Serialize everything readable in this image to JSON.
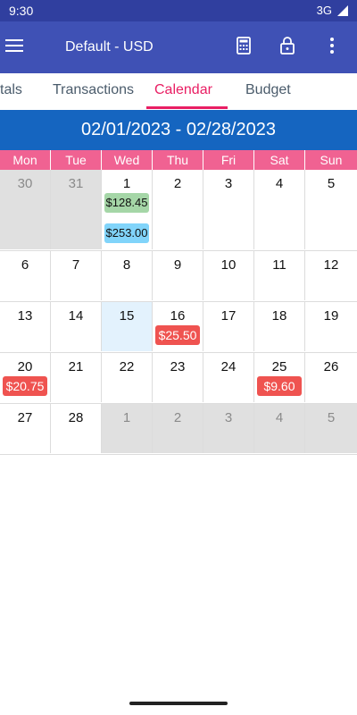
{
  "status_bar": {
    "time": "9:30",
    "network": "3G"
  },
  "app_bar": {
    "title": "Default - USD",
    "icons": [
      "menu-icon",
      "calculator-icon",
      "lock-icon",
      "more-vert-icon"
    ]
  },
  "tabs": [
    {
      "label": "tals",
      "active": false
    },
    {
      "label": "Transactions",
      "active": false
    },
    {
      "label": "Calendar",
      "active": true
    },
    {
      "label": "Budget",
      "active": false
    }
  ],
  "date_range": "02/01/2023 - 02/28/2023",
  "weekdays": [
    "Mon",
    "Tue",
    "Wed",
    "Thu",
    "Fri",
    "Sat",
    "Sun"
  ],
  "weeks": [
    [
      {
        "day": "30",
        "other": true
      },
      {
        "day": "31",
        "other": true
      },
      {
        "day": "1",
        "chips": [
          {
            "text": "$128.45",
            "color": "green"
          },
          {
            "text": "$253.00",
            "color": "blue"
          }
        ]
      },
      {
        "day": "2"
      },
      {
        "day": "3"
      },
      {
        "day": "4"
      },
      {
        "day": "5"
      }
    ],
    [
      {
        "day": "6"
      },
      {
        "day": "7"
      },
      {
        "day": "8"
      },
      {
        "day": "9"
      },
      {
        "day": "10"
      },
      {
        "day": "11"
      },
      {
        "day": "12"
      }
    ],
    [
      {
        "day": "13"
      },
      {
        "day": "14"
      },
      {
        "day": "15",
        "today": true
      },
      {
        "day": "16",
        "chips": [
          {
            "text": "$25.50",
            "color": "red"
          }
        ]
      },
      {
        "day": "17"
      },
      {
        "day": "18"
      },
      {
        "day": "19"
      }
    ],
    [
      {
        "day": "20",
        "chips": [
          {
            "text": "$20.75",
            "color": "red"
          }
        ]
      },
      {
        "day": "21"
      },
      {
        "day": "22"
      },
      {
        "day": "23"
      },
      {
        "day": "24"
      },
      {
        "day": "25",
        "chips": [
          {
            "text": "$9.60",
            "color": "red"
          }
        ]
      },
      {
        "day": "26"
      }
    ],
    [
      {
        "day": "27"
      },
      {
        "day": "28"
      },
      {
        "day": "1",
        "other": true
      },
      {
        "day": "2",
        "other": true
      },
      {
        "day": "3",
        "other": true
      },
      {
        "day": "4",
        "other": true
      },
      {
        "day": "5",
        "other": true
      }
    ]
  ],
  "colors": {
    "status_bar": "#303f9f",
    "app_bar": "#3f51b5",
    "accent": "#e91e63",
    "header": "#1565c0",
    "weekday_bar": "#f06292",
    "expense": "#ef5350",
    "income_green": "#a5d6a7",
    "income_blue": "#81d4fa"
  }
}
